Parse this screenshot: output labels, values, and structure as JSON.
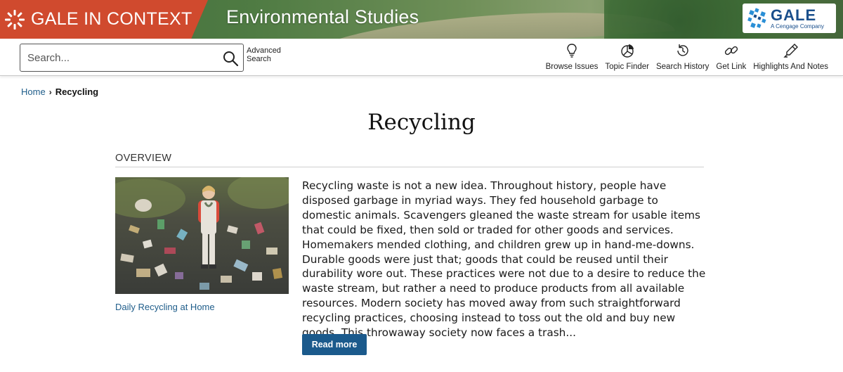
{
  "header": {
    "brand": "GALE IN CONTEXT",
    "product": "Environmental Studies",
    "publisher_logo": {
      "word": "GALE",
      "tagline": "A Cengage Company"
    }
  },
  "toolbar": {
    "search": {
      "placeholder": "Search...",
      "value": ""
    },
    "advanced_search": "Advanced Search",
    "tools": [
      {
        "label": "Browse Issues",
        "icon": "lightbulb-icon"
      },
      {
        "label": "Topic Finder",
        "icon": "pie-chart-icon"
      },
      {
        "label": "Search History",
        "icon": "history-icon"
      },
      {
        "label": "Get Link",
        "icon": "link-icon"
      },
      {
        "label": "Highlights And Notes",
        "icon": "pen-icon"
      }
    ]
  },
  "breadcrumb": {
    "home": "Home",
    "current": "Recycling"
  },
  "page": {
    "title": "Recycling",
    "overview": {
      "heading": "OVERVIEW",
      "image_caption": "Daily Recycling at Home",
      "text": "Recycling waste is not a new idea. Throughout history, people have disposed garbage in myriad ways. They fed household garbage to domestic animals. Scavengers gleaned the waste stream for usable items that could be fixed, then sold or traded for other goods and services. Homemakers mended clothing, and children grew up in hand-me-downs. Durable goods were just that; goods that could be reused until their durability wore out. These practices were not due to a desire to reduce the waste stream, but rather a need to produce products from all available resources. Modern society has moved away from such straightforward recycling practices, choosing instead to toss out the old and buy new goods. This throwaway society now faces a trash...",
      "read_more": "Read more"
    }
  },
  "colors": {
    "brand_red": "#d04a2e",
    "link_blue": "#1f5d8a",
    "button_blue": "#1b5a8c"
  }
}
